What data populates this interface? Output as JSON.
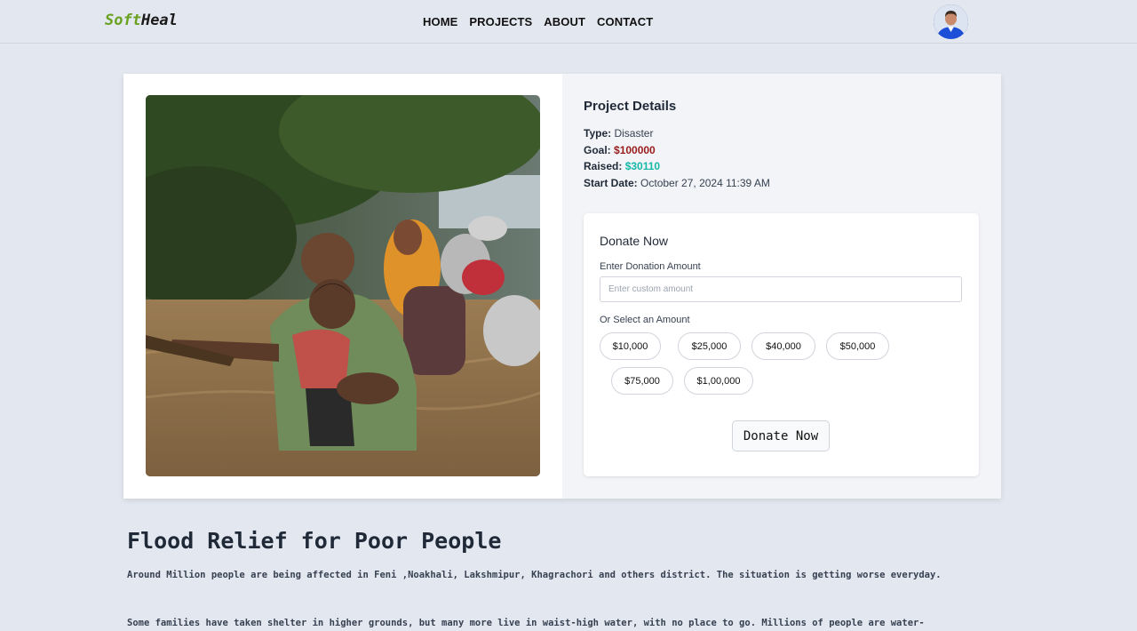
{
  "nav": {
    "logo_part1": "Soft",
    "logo_part2": "Heal",
    "links": [
      "HOME",
      "PROJECTS",
      "ABOUT",
      "CONTACT"
    ]
  },
  "project": {
    "details_title": "Project Details",
    "type_label": "Type:",
    "type_value": "Disaster",
    "goal_label": "Goal:",
    "goal_value": "$100000",
    "raised_label": "Raised:",
    "raised_value": "$30110",
    "start_label": "Start Date:",
    "start_value": "October 27, 2024 11:39 AM"
  },
  "donate": {
    "title": "Donate Now",
    "amount_label": "Enter Donation Amount",
    "amount_placeholder": "Enter custom amount",
    "select_label": "Or Select an Amount",
    "amounts": [
      "$10,000",
      "$25,000",
      "$40,000",
      "$50,000",
      "$75,000",
      "$1,00,000"
    ],
    "button_label": "Donate Now"
  },
  "article": {
    "title": "Flood Relief for Poor People",
    "para1": "Around Million people are being affected in Feni ,Noakhali, Lakshmipur, Khagrachori and others district. The situation is getting worse everyday.",
    "para2": "Some families have taken shelter in higher grounds, but many more live in waist-high water, with no place to go. Millions of people are water-"
  },
  "colors": {
    "accent_green": "#6aa121",
    "goal_red": "#991b1b",
    "raised_teal": "#14b8a6",
    "page_bg": "#e3e8f0"
  },
  "icons": {
    "avatar": "user-avatar-icon",
    "photo": "flood-photo"
  }
}
